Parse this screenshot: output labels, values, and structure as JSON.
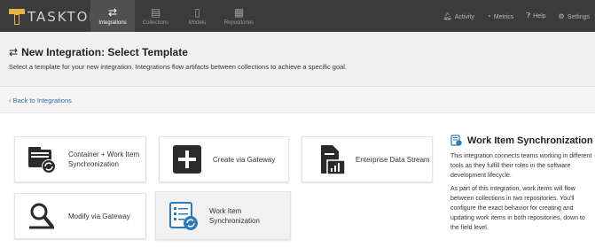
{
  "app": {
    "logo_text": "TASKTOP"
  },
  "nav": {
    "items": [
      {
        "label": "Integrations",
        "icon": "arrows-exchange-icon",
        "active": true
      },
      {
        "label": "Collections",
        "icon": "collection-icon",
        "active": false
      },
      {
        "label": "Models",
        "icon": "document-icon",
        "active": false
      },
      {
        "label": "Repositories",
        "icon": "database-icon",
        "active": false
      }
    ],
    "right": [
      {
        "label": "Activity",
        "icon": "bell-icon"
      },
      {
        "label": "Metrics",
        "icon": "gauge-icon"
      },
      {
        "label": "Help",
        "icon": "question-icon"
      },
      {
        "label": "Settings",
        "icon": "gear-icon"
      }
    ]
  },
  "header": {
    "title": "New Integration: Select Template",
    "subtitle": "Select a template for your new integration. Integrations flow artifacts between collections to achieve a specific goal."
  },
  "back": {
    "label": "Back to Integrations"
  },
  "templates": [
    {
      "label": "Container + Work Item Synchronization",
      "icon": "container-sync-icon"
    },
    {
      "label": "Create via Gateway",
      "icon": "plus-icon"
    },
    {
      "label": "Enterprise Data Stream",
      "icon": "data-stream-icon"
    },
    {
      "label": "Modify via Gateway",
      "icon": "modify-gateway-icon"
    },
    {
      "label": "Work Item Synchronization",
      "icon": "work-item-sync-icon",
      "selected": true
    }
  ],
  "panel": {
    "title": "Work Item Synchronization",
    "p1": "This integration connects teams working in different tools as they fulfill their roles in the software development lifecycle.",
    "p2": "As part of this integration, work items will flow between collections in two repositories. You'll configure the exact behavior for creating and updating work items in both repositories, down to the field level."
  },
  "colors": {
    "topbar": "#3b3b3b",
    "accent": "#2f6ea3",
    "logo": "#e8b24a"
  }
}
